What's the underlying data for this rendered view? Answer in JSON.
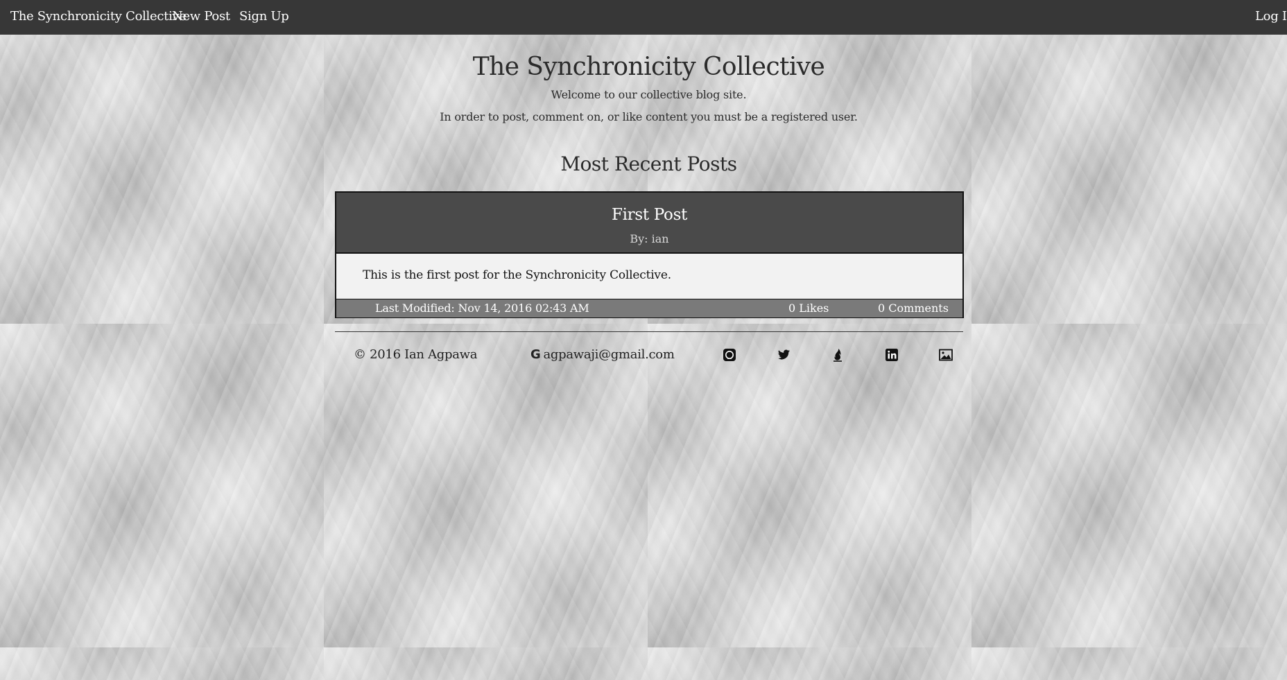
{
  "nav": {
    "brand": "The Synchronicity Collective",
    "new_post": "New Post",
    "sign_up": "Sign Up",
    "log_in": "Log In"
  },
  "header": {
    "title": "The Synchronicity Collective",
    "welcome": "Welcome to our collective blog site.",
    "instruction": "In order to post, comment on, or like content you must be a registered user."
  },
  "recent": {
    "heading": "Most Recent Posts"
  },
  "post": {
    "title": "First Post",
    "author": "By: ian",
    "body": "This is the first post for the Synchronicity Collective.",
    "last_modified": "Last Modified: Nov 14, 2016 02:43 AM",
    "likes": "0 Likes",
    "comments": "0 Comments"
  },
  "footer": {
    "copyright": "© 2016 Ian Agpawa",
    "email": "agpawaji@gmail.com",
    "social_icons": [
      "github-icon",
      "twitter-icon",
      "codepen-flame-icon",
      "linkedin-icon",
      "image-icon"
    ]
  },
  "colors": {
    "nav_bg": "#373737",
    "post_header_bg": "#4a4a4a",
    "post_footer_bg": "#7a7a7a",
    "post_body_bg": "#f2f2f2"
  }
}
